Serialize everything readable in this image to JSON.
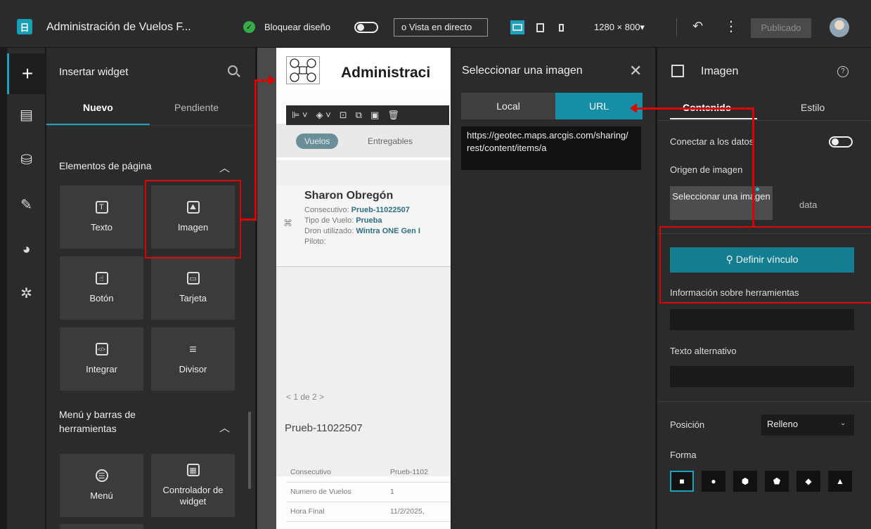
{
  "topbar": {
    "app_title": "Administración de Vuelos F...",
    "lock_label": "Bloquear diseño",
    "live_view": "o  Vista en directo",
    "resolution": "1280 × 800▾",
    "publish": "Publicado"
  },
  "rail": {
    "items": [
      "add-icon",
      "page-icon",
      "data-icon",
      "tools-icon",
      "theme-icon",
      "settings-icon"
    ]
  },
  "insert_panel": {
    "title": "Insertar widget",
    "tabs": [
      "Nuevo",
      "Pendiente"
    ],
    "sections": [
      {
        "title": "Elementos de página"
      },
      {
        "title": "Menú y barras de herramientas"
      }
    ],
    "tiles": [
      {
        "label": "Texto",
        "icon": "T"
      },
      {
        "label": "Imagen",
        "icon": "⛰"
      },
      {
        "label": "Botón",
        "icon": "☝"
      },
      {
        "label": "Tarjeta",
        "icon": "▭"
      },
      {
        "label": "Integrar",
        "icon": "</>"
      },
      {
        "label": "Divisor",
        "icon": "≡"
      },
      {
        "label": "Menú",
        "icon": "☰"
      },
      {
        "label": "Controlador de widget",
        "icon": "▦"
      }
    ]
  },
  "canvas": {
    "heading": "Administraci",
    "tabs": [
      "Vuelos",
      "Entregables"
    ],
    "card": {
      "name": "Sharon Obregón",
      "consecutivo_label": "Consecutivo:",
      "consecutivo_value": "Prueb-11022507",
      "tipo_label": "Tipo de Vuelo:",
      "tipo_value": "Prueba",
      "dron_label": "Dron utilizado:",
      "dron_value": "Wintra ONE Gen I",
      "piloto_label": "Piloto:"
    },
    "pager": "<   1 de 2   >",
    "record_title": "Prueb-11022507",
    "table": [
      [
        "Consecutivo",
        "Prueb-1102"
      ],
      [
        "Numero de Vuelos",
        "1"
      ],
      [
        "Hora Final",
        "11/2/2025,"
      ]
    ]
  },
  "dialog": {
    "title": "Seleccionar una imagen",
    "tabs": [
      "Local",
      "URL"
    ],
    "url_value": "https://geotec.maps.arcgis.com/sharing/rest/content/items/a"
  },
  "props": {
    "title": "Imagen",
    "tabs": [
      "Contenido",
      "Estilo"
    ],
    "connect_label": "Conectar a los datos",
    "source_label": "Origen de imagen",
    "select_btn": "Seleccionar una imagen",
    "data_label": "data",
    "link_btn": "⚲ Definir vínculo",
    "tooltip_label": "Información sobre herramientas",
    "alt_label": "Texto alternativo",
    "position_label": "Posición",
    "position_value": "Relleno",
    "shape_label": "Forma",
    "shapes": [
      "■",
      "●",
      "⬢",
      "⬟",
      "◆",
      "▲"
    ]
  },
  "colors": {
    "accent": "#1aa3bd",
    "annotation": "#e10000"
  }
}
